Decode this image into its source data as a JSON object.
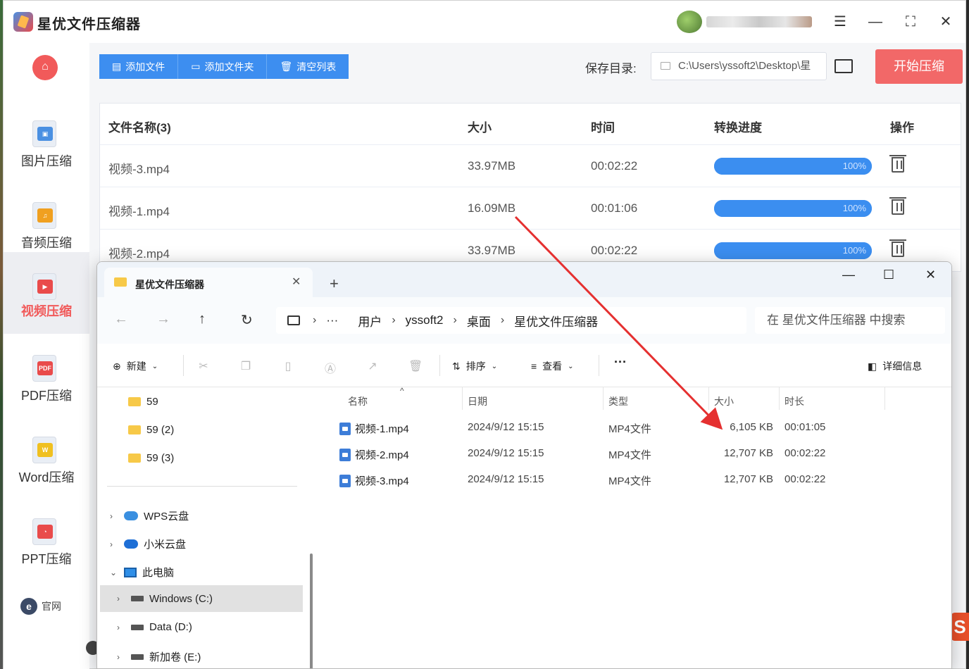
{
  "app": {
    "title": "星优文件压缩器",
    "window_controls": [
      "settings-icon",
      "minimize-icon",
      "maximize-icon",
      "close-icon"
    ]
  },
  "sidebar": {
    "items": [
      {
        "label": "图片压缩",
        "icon": "image-icon",
        "color": "#4a90e2"
      },
      {
        "label": "音频压缩",
        "icon": "music-icon",
        "color": "#f0a020"
      },
      {
        "label": "视频压缩",
        "icon": "video-icon",
        "color": "#e94b4b",
        "active": true
      },
      {
        "label": "PDF压缩",
        "icon": "pdf-icon",
        "color": "#e94b4b"
      },
      {
        "label": "Word压缩",
        "icon": "word-icon",
        "color": "#f0c020"
      },
      {
        "label": "PPT压缩",
        "icon": "ppt-icon",
        "color": "#e94b4b"
      }
    ],
    "footer": "官网"
  },
  "toolbar": {
    "add_file": "添加文件",
    "add_folder": "添加文件夹",
    "clear_list": "清空列表",
    "save_dir_label": "保存目录:",
    "save_dir_value": "C:\\Users\\yssoft2\\Desktop\\星",
    "start_button": "开始压缩"
  },
  "table": {
    "headers": [
      "文件名称(3)",
      "大小",
      "时间",
      "转换进度",
      "操作"
    ],
    "rows": [
      {
        "name": "视频-3.mp4",
        "size": "33.97MB",
        "time": "00:02:22",
        "progress": "100%",
        "progress_value": 1.0
      },
      {
        "name": "视频-1.mp4",
        "size": "16.09MB",
        "time": "00:01:06",
        "progress": "100%",
        "progress_value": 1.0
      },
      {
        "name": "视频-2.mp4",
        "size": "33.97MB",
        "time": "00:02:22",
        "progress": "100%",
        "progress_value": 1.0
      }
    ]
  },
  "explorer": {
    "tab_title": "星优文件压缩器",
    "path": [
      "用户",
      "yssoft2",
      "桌面",
      "星优文件压缩器"
    ],
    "search_placeholder": "在 星优文件压缩器 中搜索",
    "commands": {
      "new": "新建",
      "sort": "排序",
      "view": "查看",
      "more": "···",
      "details": "详细信息"
    },
    "nav_tree": [
      {
        "label": "59",
        "type": "folder"
      },
      {
        "label": "59 (2)",
        "type": "folder"
      },
      {
        "label": "59 (3)",
        "type": "folder"
      },
      {
        "label": "WPS云盘",
        "type": "cloud"
      },
      {
        "label": "小米云盘",
        "type": "cloud"
      },
      {
        "label": "此电脑",
        "type": "pc"
      },
      {
        "label": "Windows (C:)",
        "type": "drive"
      },
      {
        "label": "Data (D:)",
        "type": "drive"
      },
      {
        "label": "新加卷 (E:)",
        "type": "drive"
      }
    ],
    "columns": [
      "名称",
      "日期",
      "类型",
      "大小",
      "时长"
    ],
    "files": [
      {
        "name": "视频-1.mp4",
        "date": "2024/9/12 15:15",
        "type": "MP4文件",
        "size": "6,105 KB",
        "duration": "00:01:05"
      },
      {
        "name": "视频-2.mp4",
        "date": "2024/9/12 15:15",
        "type": "MP4文件",
        "size": "12,707 KB",
        "duration": "00:02:22"
      },
      {
        "name": "视频-3.mp4",
        "date": "2024/9/12 15:15",
        "type": "MP4文件",
        "size": "12,707 KB",
        "duration": "00:02:22"
      }
    ]
  },
  "colors": {
    "primary": "#3d8ef0",
    "accent": "#f26868",
    "arrow": "#e53030"
  }
}
